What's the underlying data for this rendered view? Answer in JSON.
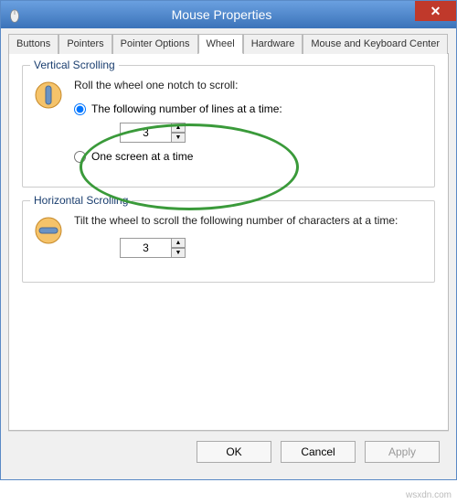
{
  "window": {
    "title": "Mouse Properties"
  },
  "tabs": [
    {
      "label": "Buttons"
    },
    {
      "label": "Pointers"
    },
    {
      "label": "Pointer Options"
    },
    {
      "label": "Wheel",
      "active": true
    },
    {
      "label": "Hardware"
    },
    {
      "label": "Mouse and Keyboard Center"
    }
  ],
  "vertical": {
    "title": "Vertical Scrolling",
    "instruction": "Roll the wheel one notch to scroll:",
    "option_lines": {
      "label": "The following number of lines at a time:",
      "selected": true
    },
    "lines_value": "3",
    "option_screen": {
      "label": "One screen at a time",
      "selected": false
    }
  },
  "horizontal": {
    "title": "Horizontal Scrolling",
    "instruction": "Tilt the wheel to scroll the following number of characters at a time:",
    "chars_value": "3"
  },
  "buttons": {
    "ok": "OK",
    "cancel": "Cancel",
    "apply": "Apply"
  },
  "watermark": "wsxdn.com"
}
